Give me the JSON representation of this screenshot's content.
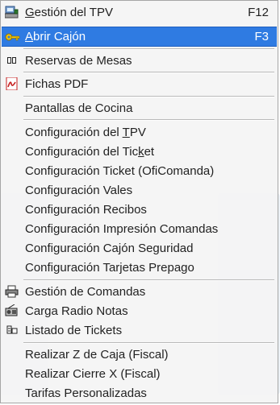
{
  "menu": {
    "items": [
      {
        "prefix": "",
        "mnemonic": "G",
        "suffix": "estión del TPV",
        "shortcut": "F12",
        "icon": "pos-terminal-icon"
      },
      {
        "prefix": "",
        "mnemonic": "A",
        "suffix": "brir Cajón",
        "shortcut": "F3",
        "icon": "key-icon"
      },
      {
        "prefix": "Reservas de Mesas",
        "mnemonic": "",
        "suffix": "",
        "shortcut": "",
        "icon": "book-icon"
      },
      {
        "prefix": "Fichas PDF",
        "mnemonic": "",
        "suffix": "",
        "shortcut": "",
        "icon": "pdf-icon"
      },
      {
        "prefix": "Pantallas de Cocina",
        "mnemonic": "",
        "suffix": "",
        "shortcut": "",
        "icon": ""
      },
      {
        "prefix": "Configuración del ",
        "mnemonic": "T",
        "suffix": "PV",
        "shortcut": "",
        "icon": ""
      },
      {
        "prefix": "Configuración del Tic",
        "mnemonic": "k",
        "suffix": "et",
        "shortcut": "",
        "icon": ""
      },
      {
        "prefix": "Configuración Ticket (OfiComanda)",
        "mnemonic": "",
        "suffix": "",
        "shortcut": "",
        "icon": ""
      },
      {
        "prefix": "Configuración Vales",
        "mnemonic": "",
        "suffix": "",
        "shortcut": "",
        "icon": ""
      },
      {
        "prefix": "Configuración Recibos",
        "mnemonic": "",
        "suffix": "",
        "shortcut": "",
        "icon": ""
      },
      {
        "prefix": "Configuración Impresión Comandas",
        "mnemonic": "",
        "suffix": "",
        "shortcut": "",
        "icon": ""
      },
      {
        "prefix": "Configuración Cajón Seguridad",
        "mnemonic": "",
        "suffix": "",
        "shortcut": "",
        "icon": ""
      },
      {
        "prefix": "Configuración Tarjetas Prepago",
        "mnemonic": "",
        "suffix": "",
        "shortcut": "",
        "icon": ""
      },
      {
        "prefix": "Gestión de Comandas",
        "mnemonic": "",
        "suffix": "",
        "shortcut": "",
        "icon": "printer-icon"
      },
      {
        "prefix": "Carga Radio Notas",
        "mnemonic": "",
        "suffix": "",
        "shortcut": "",
        "icon": "radio-icon"
      },
      {
        "prefix": "Listado de Tickets",
        "mnemonic": "",
        "suffix": "",
        "shortcut": "",
        "icon": "ticket-list-icon"
      },
      {
        "prefix": "Realizar Z de Caja (Fiscal)",
        "mnemonic": "",
        "suffix": "",
        "shortcut": "",
        "icon": ""
      },
      {
        "prefix": "Realizar Cierre X (Fiscal)",
        "mnemonic": "",
        "suffix": "",
        "shortcut": "",
        "icon": ""
      },
      {
        "prefix": "Tarifas Personalizadas",
        "mnemonic": "",
        "suffix": "",
        "shortcut": "",
        "icon": ""
      }
    ],
    "highlighted_index": 1,
    "colors": {
      "highlight": "#2f7be2",
      "text": "#222222",
      "separator": "#b9b9b9"
    }
  }
}
